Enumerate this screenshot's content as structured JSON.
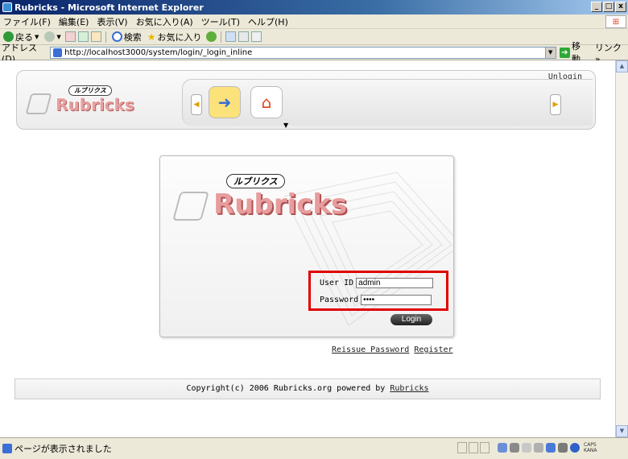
{
  "window": {
    "title": "Rubricks - Microsoft Internet Explorer",
    "buttons": [
      "_",
      "□",
      "x"
    ]
  },
  "menu": {
    "items": [
      "ファイル(F)",
      "編集(E)",
      "表示(V)",
      "お気に入り(A)",
      "ツール(T)",
      "ヘルプ(H)"
    ]
  },
  "toolbar": {
    "back_label": "戻る",
    "search_label": "検索",
    "favorites_label": "お気に入り"
  },
  "address": {
    "label": "アドレス(D)",
    "url": "http://localhost3000/system/login/_login_inline",
    "go_label": "移動",
    "links_label": "リンク »"
  },
  "banner": {
    "unlogin": "Unlogin",
    "brand_kana": "ルブリクス",
    "brand_word": "Rubricks"
  },
  "login": {
    "brand_kana": "ルブリクス",
    "brand_word": "Rubricks",
    "user_label": "User ID",
    "user_value": "admin",
    "password_label": "Password",
    "password_value": "••••",
    "login_button": "Login",
    "reissue_link": "Reissue Password",
    "register_link": "Register",
    "highlight_color": "#e00000"
  },
  "footer": {
    "copyright": "Copyright(c) 2006 Rubricks.org powered by",
    "link": "Rubricks"
  },
  "status": {
    "text": "ページが表示されました",
    "caps": "CAPS",
    "kana": "KANA"
  }
}
